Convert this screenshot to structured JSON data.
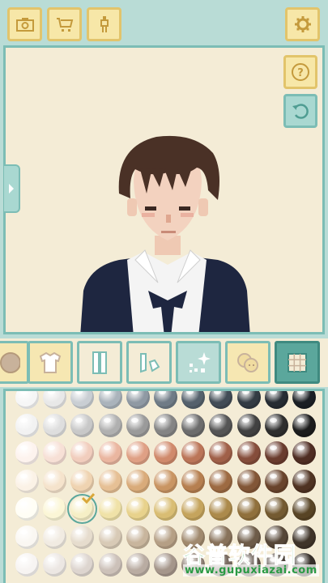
{
  "toolbar": {
    "camera_icon": "camera-icon",
    "cart_icon": "cart-icon",
    "figure_icon": "person-icon",
    "settings_icon": "gear-icon"
  },
  "preview": {
    "help_label": "?",
    "help_icon": "question-icon",
    "undo_icon": "rotate-icon",
    "drawer_icon": "chevron-right-icon"
  },
  "categories": [
    {
      "id": "face",
      "icon": "face-icon",
      "selected": false
    },
    {
      "id": "tops",
      "icon": "shirt-icon",
      "selected": false
    },
    {
      "id": "bottoms",
      "icon": "pants-icon",
      "selected": false
    },
    {
      "id": "shoes",
      "icon": "shoes-icon",
      "selected": false
    },
    {
      "id": "accessories",
      "icon": "sparkle-icon",
      "selected": false
    },
    {
      "id": "expressions",
      "icon": "faces-icon",
      "selected": false
    },
    {
      "id": "background",
      "icon": "grid-icon",
      "selected": true
    }
  ],
  "palette": {
    "selected_row": 4,
    "selected_col": 2,
    "rows": [
      [
        "#f6f6f6",
        "#e8e8e8",
        "#c9ced3",
        "#aab3bb",
        "#8f99a3",
        "#6f7b86",
        "#55616c",
        "#424c56",
        "#333b43",
        "#262c33",
        "#1b1f24"
      ],
      [
        "#f2f2f2",
        "#dedede",
        "#c8c8c8",
        "#b0b0b0",
        "#9a9a9a",
        "#848484",
        "#6c6c6c",
        "#555555",
        "#414141",
        "#2e2e2e",
        "#1c1c1c"
      ],
      [
        "#fdf3ee",
        "#f7e0d6",
        "#f1cdbd",
        "#eab6a0",
        "#dfa085",
        "#d08a6c",
        "#bb7558",
        "#a06049",
        "#854d3b",
        "#6a3c2e",
        "#4f2d23"
      ],
      [
        "#fbf2e6",
        "#f5e3cc",
        "#efd3b1",
        "#e6c095",
        "#d9ab7a",
        "#c99563",
        "#b67f50",
        "#9d6a42",
        "#825637",
        "#69442c",
        "#4f3322"
      ],
      [
        "#fffef5",
        "#fbf6d6",
        "#f6efc6",
        "#f0e2a8",
        "#e8d28c",
        "#d9bd73",
        "#c5a45d",
        "#ac8a4b",
        "#90703c",
        "#745a31",
        "#584425"
      ],
      [
        "#faf7f2",
        "#f1ebe2",
        "#e6dccd",
        "#d8cab6",
        "#c8b59d",
        "#b59f85",
        "#a0896e",
        "#88725b",
        "#6e5c49",
        "#564738",
        "#3f3429"
      ],
      [
        "#f7f4f2",
        "#ece7e3",
        "#ddd5cf",
        "#ccc1b9",
        "#b9aca2",
        "#a5968b",
        "#8f8075",
        "#786a60",
        "#61554c",
        "#4b4139",
        "#362f29"
      ]
    ]
  },
  "watermark": {
    "title": "谷普软件园",
    "url": "www.gupuxiazai.com"
  }
}
